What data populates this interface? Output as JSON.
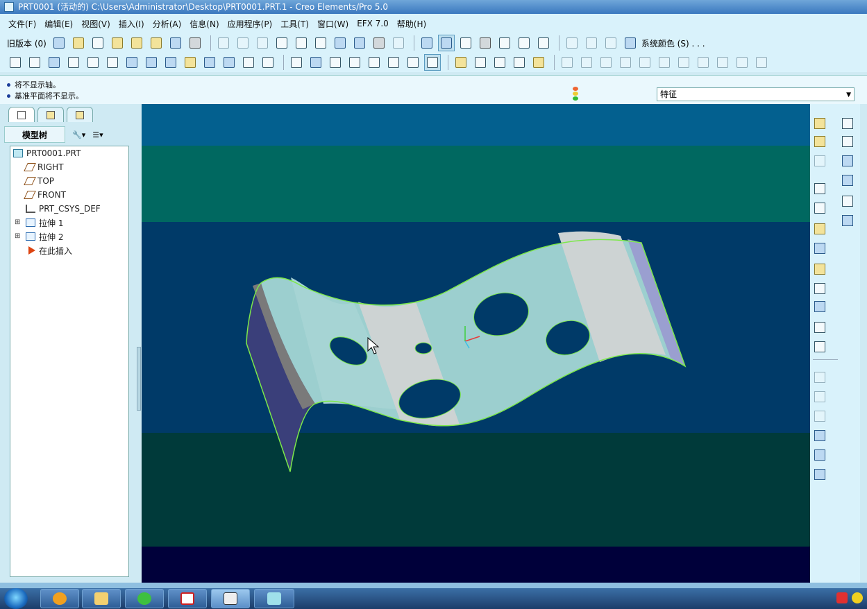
{
  "window": {
    "title": "PRT0001 (活动的) C:\\Users\\Administrator\\Desktop\\PRT0001.PRT.1 - Creo Elements/Pro 5.0"
  },
  "menu": [
    "文件(F)",
    "编辑(E)",
    "视图(V)",
    "插入(I)",
    "分析(A)",
    "信息(N)",
    "应用程序(P)",
    "工具(T)",
    "窗口(W)",
    "EFX 7.0",
    "帮助(H)"
  ],
  "toolbar": {
    "old_version_label": "旧版本",
    "old_version_count": "(0)",
    "system_colors_label": "系统颜色 (S) . . ."
  },
  "messages": [
    "将不显示轴。",
    "基准平面将不显示。"
  ],
  "filter": {
    "value": "特征"
  },
  "model_tree": {
    "header": "模型树",
    "items": [
      {
        "label": "PRT0001.PRT",
        "icon": "part-icon"
      },
      {
        "label": "RIGHT",
        "icon": "datum-plane-icon"
      },
      {
        "label": "TOP",
        "icon": "datum-plane-icon"
      },
      {
        "label": "FRONT",
        "icon": "datum-plane-icon"
      },
      {
        "label": "PRT_CSYS_DEF",
        "icon": "csys-icon"
      },
      {
        "label": "拉伸 1",
        "icon": "extrude-icon"
      },
      {
        "label": "拉伸 2",
        "icon": "extrude-icon"
      },
      {
        "label": "在此插入",
        "icon": "insert-here-arrow-icon"
      }
    ]
  },
  "colors": {
    "viewport_bands": [
      "#03608f",
      "#006860",
      "#003a68",
      "#003a3a",
      "#00003a"
    ],
    "surface": "#9ccfcf",
    "surface_light": "#cdd3d3",
    "edge_highlight": "#7ce84a",
    "accent": "#2c7a9a"
  }
}
